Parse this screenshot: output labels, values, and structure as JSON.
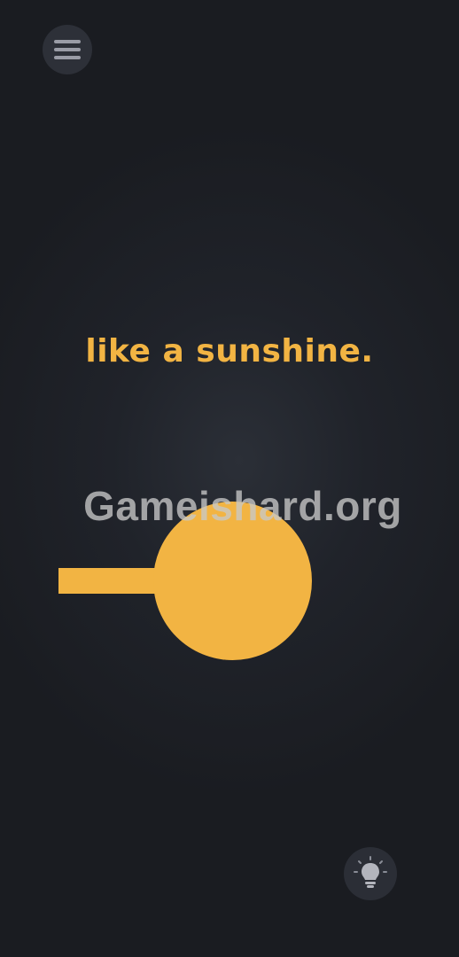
{
  "level": {
    "phrase": "like a sunshine.",
    "accent_color": "#f2b443"
  },
  "watermark": {
    "text": "Gameishard.org"
  },
  "buttons": {
    "menu_icon": "hamburger-menu-icon",
    "hint_icon": "lightbulb-icon"
  },
  "pieces": {
    "stick_color": "#f2b443",
    "sun_color": "#f2b443"
  }
}
